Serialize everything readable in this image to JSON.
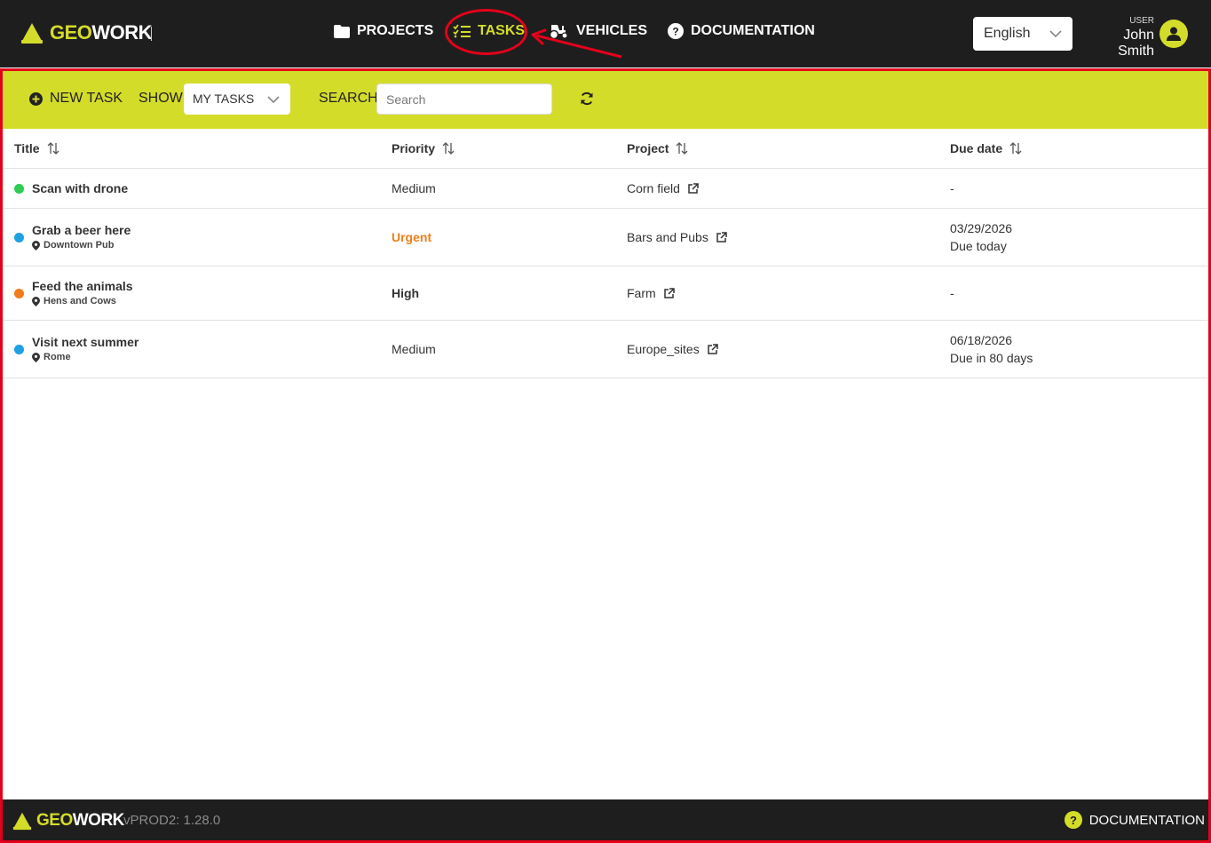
{
  "brand": {
    "geo": "GEO",
    "work": "WORK",
    "accent_color": "#d4dc2a",
    "dark_color": "#1e1e1e"
  },
  "nav": {
    "projects": "PROJECTS",
    "tasks": "TASKS",
    "vehicles": "VEHICLES",
    "documentation": "DOCUMENTATION",
    "active": "tasks"
  },
  "language": {
    "selected": "English"
  },
  "user": {
    "role": "USER",
    "name": "John Smith"
  },
  "toolbar": {
    "new_task": "NEW TASK",
    "show_label": "SHOW:",
    "show_selected": "MY TASKS",
    "search_label": "SEARCH:",
    "search_placeholder": "Search",
    "search_value": ""
  },
  "table": {
    "columns": [
      "Title",
      "Priority",
      "Project",
      "Due date"
    ],
    "rows": [
      {
        "status_color": "#2ecc55",
        "title": "Scan with drone",
        "location": "",
        "priority": "Medium",
        "project": "Corn field",
        "due_date": "-",
        "due_note": ""
      },
      {
        "status_color": "#1da1e2",
        "title": "Grab a beer here",
        "location": "Downtown Pub",
        "priority": "Urgent",
        "project": "Bars and Pubs",
        "due_date": "03/29/2026",
        "due_note": "Due today"
      },
      {
        "status_color": "#f07d1a",
        "title": "Feed the animals",
        "location": "Hens and Cows",
        "priority": "High",
        "project": "Farm",
        "due_date": "-",
        "due_note": ""
      },
      {
        "status_color": "#1da1e2",
        "title": "Visit next summer",
        "location": "Rome",
        "priority": "Medium",
        "project": "Europe_sites",
        "due_date": "06/18/2026",
        "due_note": "Due in 80 days"
      }
    ]
  },
  "footer": {
    "version": "vPROD2: 1.28.0",
    "documentation": "DOCUMENTATION"
  }
}
